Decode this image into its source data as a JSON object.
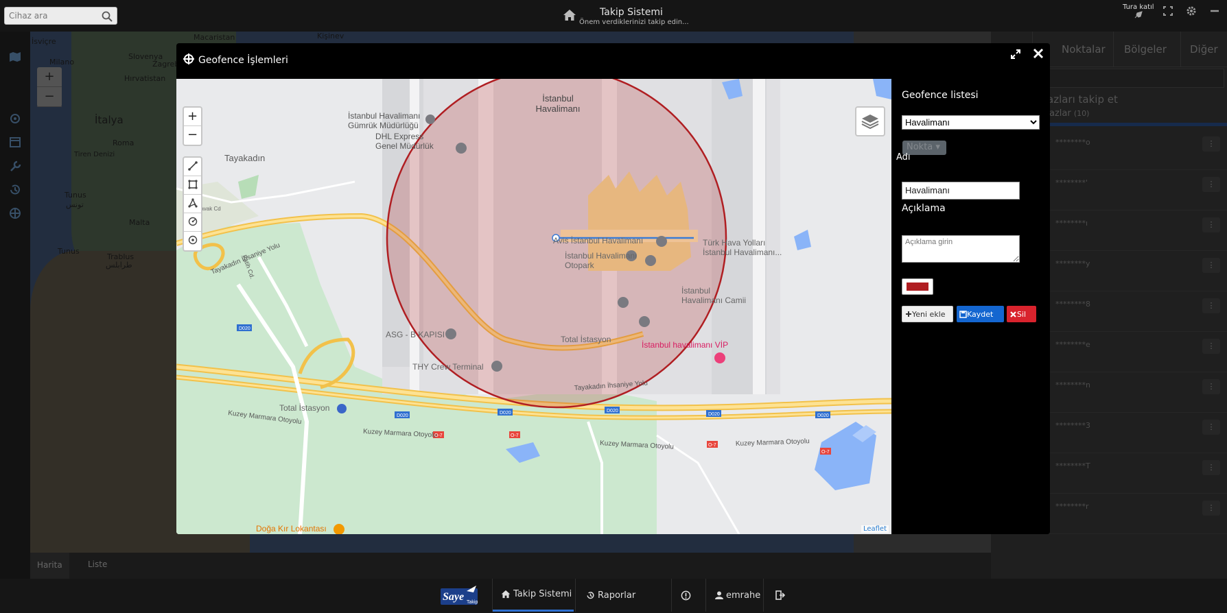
{
  "topbar": {
    "search_placeholder": "Cihaz ara",
    "title": "Takip Sistemi",
    "subtitle": "Önem verdiklerinizi takip edin...",
    "tour_label": "Tura katıl"
  },
  "background_map": {
    "labels": [
      "İsviçre",
      "Macaristan",
      "Milano",
      "Slovenya",
      "Zagreb",
      "Hırvatistan",
      "İtalya",
      "Roma",
      "Tiren Denizi",
      "Tunus",
      "تونس",
      "Malta",
      "Tunus",
      "Trablus",
      "طرابلس",
      "Kişinev"
    ],
    "zoom_in": "+",
    "zoom_out": "−",
    "tabs": [
      "Harita",
      "Liste"
    ]
  },
  "right_panel": {
    "tabs": [
      "Noktalar",
      "Bölgeler",
      "Diğer"
    ],
    "info_line1": "azları takip et",
    "info_line2": "azlar",
    "info_count": "(10)",
    "rows": [
      {
        "name": "********o"
      },
      {
        "name": "********'"
      },
      {
        "name": "********ı"
      },
      {
        "name": "********y"
      },
      {
        "name": "********8"
      },
      {
        "name": "********e"
      },
      {
        "name": "********n"
      },
      {
        "name": "********3"
      },
      {
        "name": "********T"
      },
      {
        "name": "********r"
      }
    ]
  },
  "modal": {
    "title": "Geofence İşlemleri",
    "map": {
      "attribution": "Leaflet",
      "zoom_in": "+",
      "zoom_out": "−",
      "labels": {
        "istanbul_havalimani": "İstanbul\nHavalimanı",
        "gumruk": "İstanbul Havalimanı\nGümrük Müdürlüğü",
        "dhl": "DHL Express\nGenel Müdürlük",
        "tayakadin": "Tayakadın",
        "avis": "Avis İstanbul Havalimanı",
        "turk_hava": "Türk Hava Yolları\nİstanbul Havalimanı...",
        "otopark": "İstanbul Havalimanı\nOtopark",
        "asg": "ASG - B KAPISI",
        "cami": "İstanbul\nHavalimanı Camii",
        "total1": "Total İstasyon",
        "vip": "İstanbul havalimanı VİP",
        "thy": "THY Crew Terminal",
        "ihsaniye1": "Tayakadın İhsaniye Yolu",
        "ihsaniye2": "Tayakadın İhsaniye Yolu",
        "fatih": "Fatih Cd.",
        "total2": "Total İstasyon",
        "kuzey1": "Kuzey Marmara Otoyolu",
        "kuzey2": "Kuzey Marmara Otoyolu",
        "kuzey3": "Kuzey Marmara Otoyolu",
        "kuzey4": "Kuzey Marmara Otoyolu",
        "doga": "Doğa Kır Lokantası",
        "kavak": "Kavak Cd",
        "d020": "D020",
        "o7": "O-7"
      },
      "geofence_color": "#b01e22"
    },
    "side": {
      "list_label": "Geofence listesi",
      "selected": "Havalimanı",
      "nokta_label": "Nokta",
      "name_label": "Adı",
      "name_value": "Havalimanı",
      "desc_label": "Açıklama",
      "desc_placeholder": "Açıklama girin",
      "btn_new": "Yeni ekle",
      "btn_save": "Kaydet",
      "btn_delete": "Sil"
    }
  },
  "bottombar": {
    "logo_text": "Saye",
    "logo_sub": "Takip",
    "nav_takip": "Takip Sistemi",
    "nav_raporlar": "Raporlar",
    "user": "emrahe"
  }
}
